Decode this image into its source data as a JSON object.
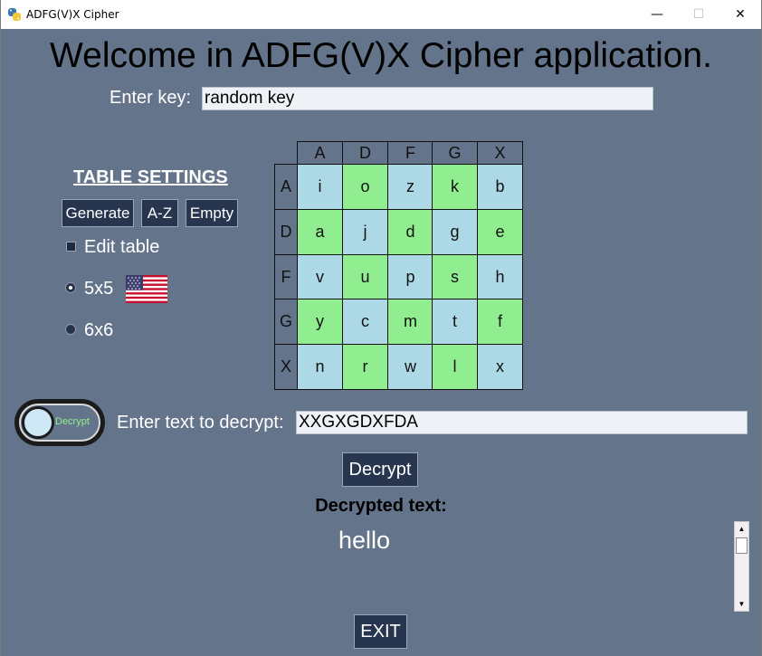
{
  "window": {
    "title": "ADFG(V)X Cipher",
    "minimize": "—",
    "maximize": "☐",
    "close": "✕"
  },
  "heading": "Welcome in ADFG(V)X Cipher application.",
  "key": {
    "label": "Enter key:",
    "value": "random key"
  },
  "settings": {
    "title": "TABLE SETTINGS",
    "buttons": {
      "generate": "Generate",
      "az": "A-Z",
      "empty": "Empty"
    },
    "edit_table": "Edit table",
    "size_5x5": "5x5",
    "size_6x6": "6x6",
    "selected_size": "5x5",
    "flag": "us-flag-icon"
  },
  "table": {
    "headers": [
      "A",
      "D",
      "F",
      "G",
      "X"
    ],
    "rows": [
      [
        "i",
        "o",
        "z",
        "k",
        "b"
      ],
      [
        "a",
        "j",
        "d",
        "g",
        "e"
      ],
      [
        "v",
        "u",
        "p",
        "s",
        "h"
      ],
      [
        "y",
        "c",
        "m",
        "t",
        "f"
      ],
      [
        "n",
        "r",
        "w",
        "l",
        "x"
      ]
    ],
    "colors": {
      "blue": "#add8e6",
      "green": "#90ee90"
    }
  },
  "mode": {
    "toggle_label": "Decrypt",
    "input_label": "Enter text to decrypt:",
    "input_value": "XXGXGDXFDA"
  },
  "decrypt_button": "Decrypt",
  "result": {
    "label": "Decrypted text:",
    "value": "hello"
  },
  "exit_button": "EXIT",
  "colors": {
    "background": "#64748b",
    "button": "#27354f"
  }
}
